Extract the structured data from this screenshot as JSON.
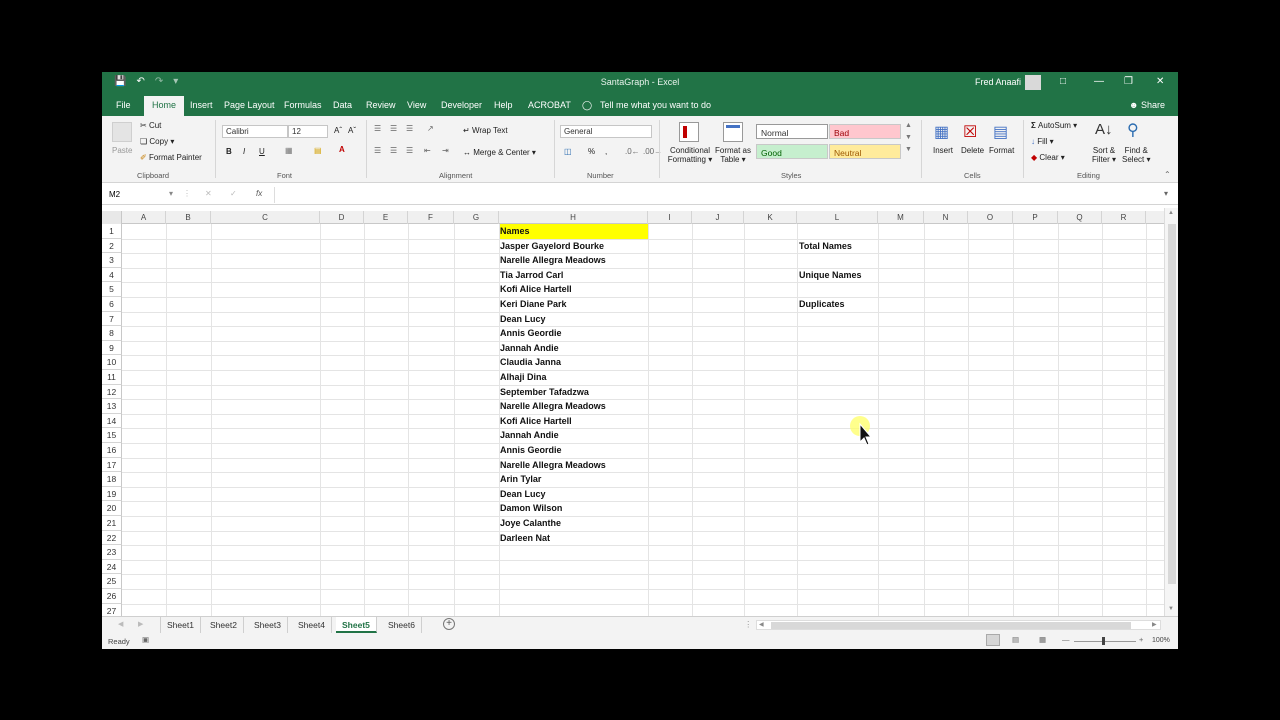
{
  "window": {
    "title": "SantaGraph - Excel",
    "user": "Fred Anaafi"
  },
  "colors": {
    "brand": "#217346",
    "header_fill": "#ffff00",
    "bad_fill": "#ffc7ce",
    "good_fill": "#c6efce",
    "neutral_fill": "#ffeb9c"
  },
  "tabs": [
    "File",
    "Home",
    "Insert",
    "Page Layout",
    "Formulas",
    "Data",
    "Review",
    "View",
    "Developer",
    "Help",
    "ACROBAT"
  ],
  "tell_me": "Tell me what you want to do",
  "share": "Share",
  "ribbon": {
    "clipboard": {
      "paste": "Paste",
      "cut": "Cut",
      "copy": "Copy",
      "format_painter": "Format Painter",
      "label": "Clipboard"
    },
    "font": {
      "family": "Calibri",
      "size": "12",
      "bold": "B",
      "italic": "I",
      "underline": "U",
      "label": "Font"
    },
    "alignment": {
      "wrap_text": "Wrap Text",
      "merge_center": "Merge & Center",
      "label": "Alignment"
    },
    "number": {
      "format": "General",
      "label": "Number"
    },
    "styles": {
      "conditional": "Conditional",
      "conditional2": "Formatting",
      "format_as": "Format as",
      "format_as2": "Table",
      "normal": "Normal",
      "bad": "Bad",
      "good": "Good",
      "neutral": "Neutral",
      "label": "Styles"
    },
    "cells": {
      "insert": "Insert",
      "delete": "Delete",
      "format": "Format",
      "label": "Cells"
    },
    "editing": {
      "autosum": "AutoSum",
      "fill": "Fill",
      "clear": "Clear",
      "sort": "Sort &",
      "sort2": "Filter",
      "find": "Find &",
      "find2": "Select",
      "label": "Editing"
    }
  },
  "formula_bar": {
    "name_box": "M2",
    "fx": "fx",
    "value": ""
  },
  "columns": [
    "A",
    "B",
    "C",
    "D",
    "E",
    "F",
    "G",
    "H",
    "I",
    "J",
    "K",
    "L",
    "M",
    "N",
    "O",
    "P",
    "Q",
    "R"
  ],
  "rows": [
    "1",
    "2",
    "3",
    "4",
    "5",
    "6",
    "7",
    "8",
    "9",
    "10",
    "11",
    "12",
    "13",
    "14",
    "15",
    "16",
    "17",
    "18",
    "19",
    "20",
    "21",
    "22",
    "23",
    "24",
    "25",
    "26",
    "27"
  ],
  "sheet": {
    "H": [
      "Names",
      "Jasper Gayelord Bourke",
      "Narelle Allegra Meadows",
      "Tia Jarrod Carl",
      "Kofi Alice Hartell",
      "Keri Diane Park",
      "Dean Lucy",
      "Annis Geordie",
      "Jannah Andie",
      "Claudia Janna",
      "Alhaji Dina",
      "September Tafadzwa",
      "Narelle Allegra Meadows",
      "Kofi Alice Hartell",
      "Jannah Andie",
      "Annis Geordie",
      "Narelle Allegra Meadows",
      "Arin Tylar",
      "Dean Lucy",
      "Damon Wilson",
      "Joye Calanthe",
      "Darleen Nat"
    ],
    "L2": "Total Names",
    "L4": "Unique Names",
    "L6": "Duplicates"
  },
  "sheet_tabs": [
    "Sheet1",
    "Sheet2",
    "Sheet3",
    "Sheet4",
    "Sheet5",
    "Sheet6"
  ],
  "active_sheet": "Sheet5",
  "status": {
    "ready": "Ready",
    "zoom": "100%"
  }
}
